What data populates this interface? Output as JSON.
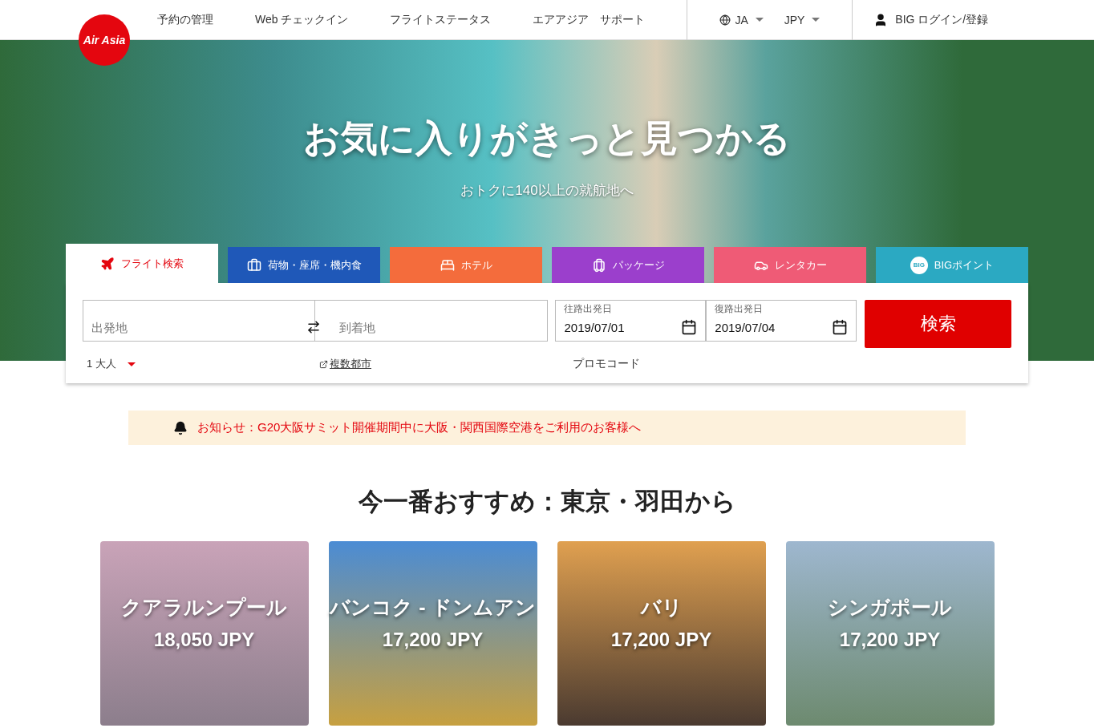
{
  "header": {
    "logo": "Air Asia",
    "nav": [
      "予約の管理",
      "Web チェックイン",
      "フライトステータス",
      "エアアジア　サポート"
    ],
    "language": "JA",
    "currency": "JPY",
    "login": "BIG ログイン/登録"
  },
  "hero": {
    "title": "お気に入りがきっと見つかる",
    "subtitle": "おトクに140以上の就航地へ"
  },
  "tabs": [
    {
      "kind": "plane",
      "label": "フライト検索",
      "selected": true,
      "color": "#ffffff"
    },
    {
      "kind": "luggage",
      "label": "荷物・座席・機内食",
      "selected": false,
      "color": "#1f58b8"
    },
    {
      "kind": "bed",
      "label": "ホテル",
      "selected": false,
      "color": "#f46c3c"
    },
    {
      "kind": "package",
      "label": "パッケージ",
      "selected": false,
      "color": "#9b3fcc"
    },
    {
      "kind": "car",
      "label": "レンタカー",
      "selected": false,
      "color": "#ef5b76"
    },
    {
      "kind": "big",
      "label": "BIGポイント",
      "badge": "BIG",
      "selected": false,
      "color": "#2ba9c2"
    }
  ],
  "search": {
    "origin_placeholder": "出発地",
    "destination_placeholder": "到着地",
    "depart": {
      "label": "往路出発日",
      "value": "2019/07/01"
    },
    "return": {
      "label": "復路出発日",
      "value": "2019/07/04"
    },
    "button": "検索",
    "passengers": "1 大人",
    "multi_city": "複数都市",
    "promo": "プロモコード"
  },
  "notice": "お知らせ：G20大阪サミット開催期間中に大阪・関西国際空港をご利用のお客様へ",
  "section_title": "今一番おすすめ：東京・羽田から",
  "destinations": [
    {
      "name": "クアラルンプール",
      "price": "18,050 JPY"
    },
    {
      "name": "バンコク - ドンムアン",
      "price": "17,200 JPY"
    },
    {
      "name": "バリ",
      "price": "17,200 JPY"
    },
    {
      "name": "シンガポール",
      "price": "17,200 JPY"
    }
  ]
}
